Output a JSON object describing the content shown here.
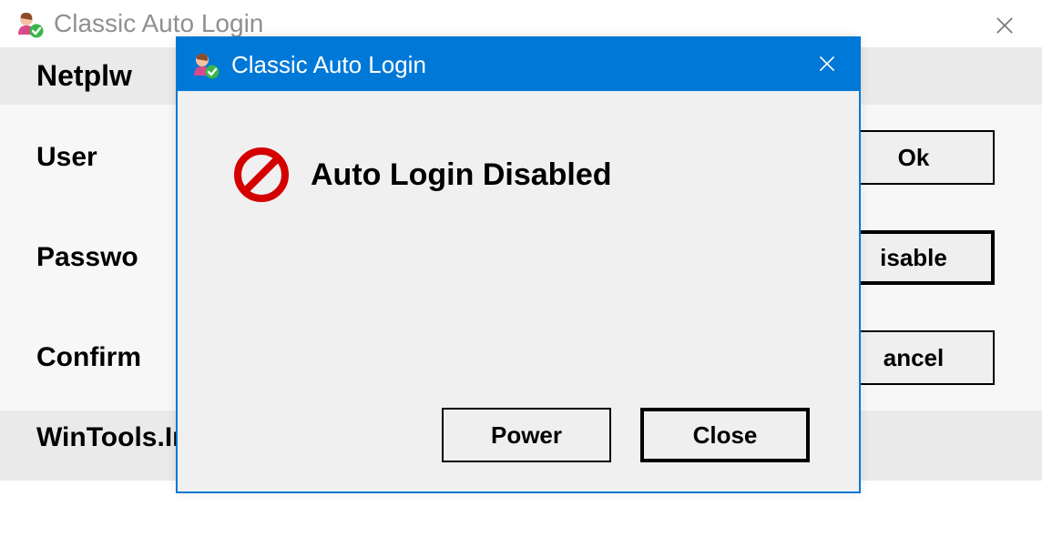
{
  "mainWindow": {
    "title": "Classic Auto Login",
    "sectionHeader": "Netplw",
    "labels": {
      "user": "User",
      "password": "Passwo",
      "confirm": "Confirm"
    },
    "buttons": {
      "ok": "Ok",
      "disable": "isable",
      "cancel": "ancel"
    },
    "footer": "WinTools.Info"
  },
  "dialog": {
    "title": "Classic Auto Login",
    "message": "Auto Login Disabled",
    "buttons": {
      "power": "Power",
      "close": "Close"
    }
  }
}
